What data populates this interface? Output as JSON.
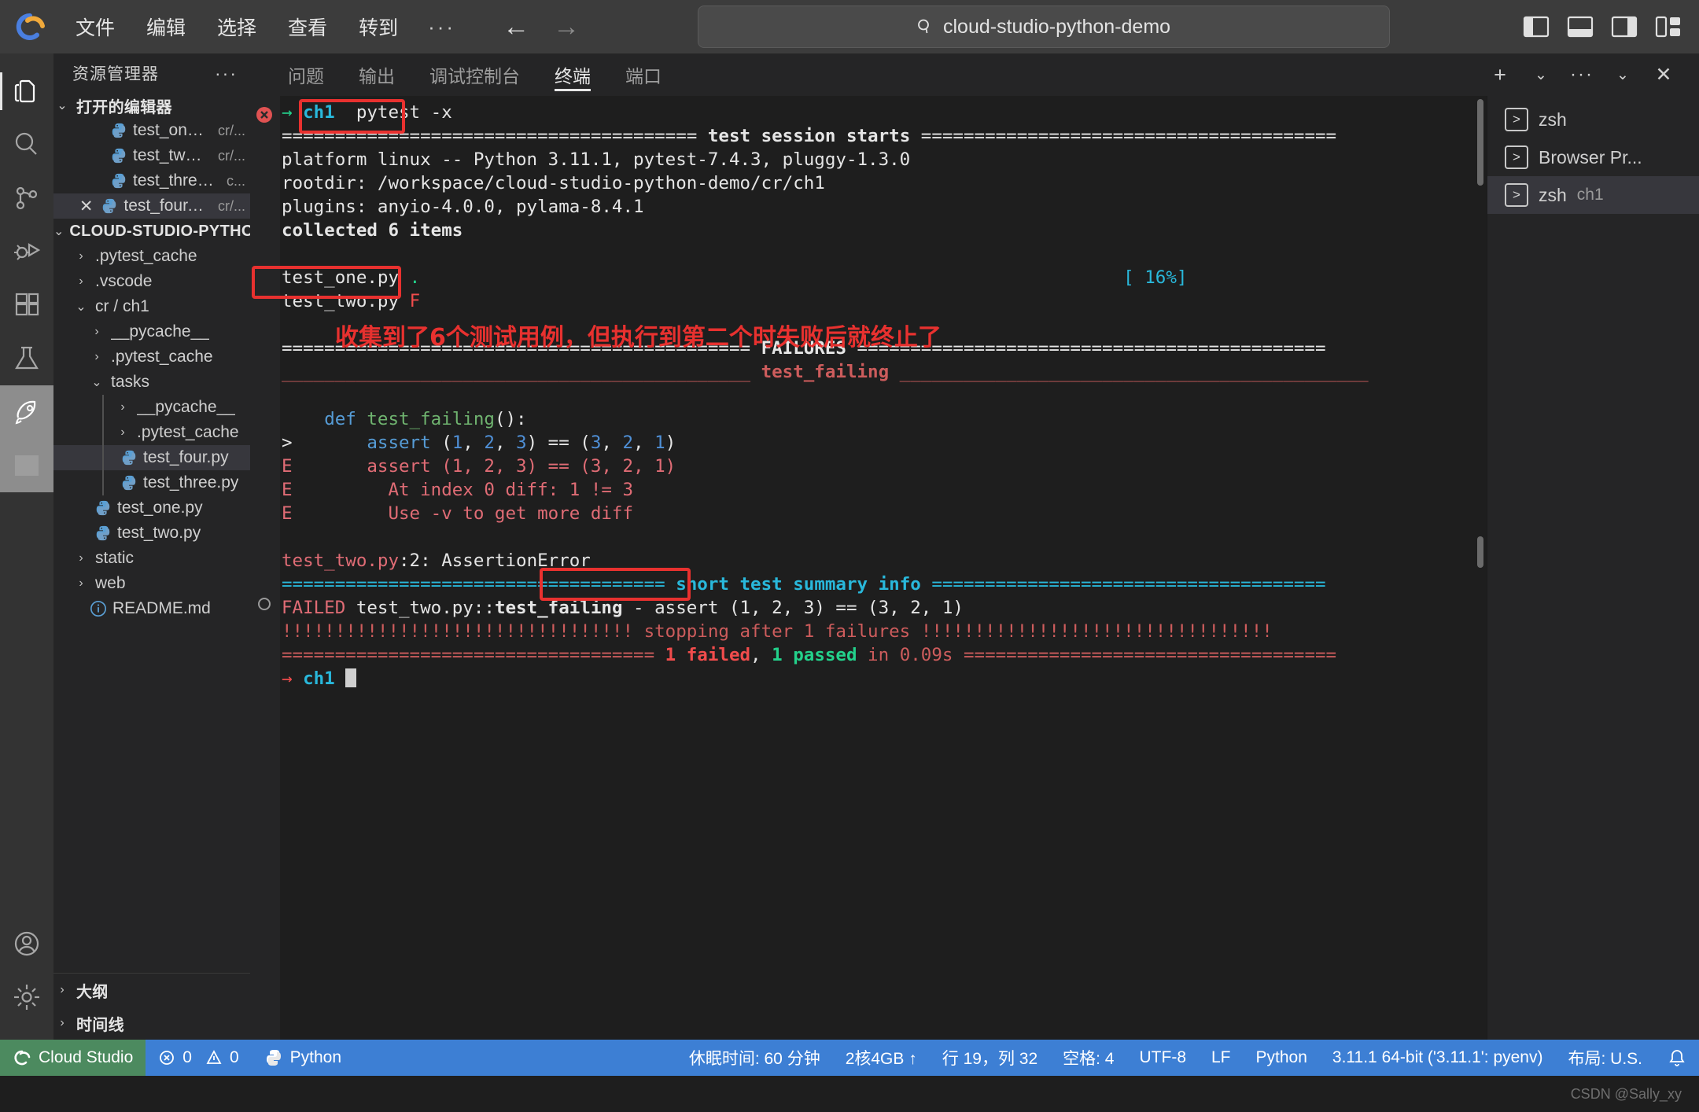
{
  "titlebar": {
    "menu": [
      "文件",
      "编辑",
      "选择",
      "查看",
      "转到"
    ],
    "more": "···",
    "back_icon": "arrow-left-icon",
    "forward_icon": "arrow-right-icon",
    "search_value": "cloud-studio-python-demo",
    "search_icon": "search-icon",
    "layout_icons": [
      "toggle-primary-sidebar-icon",
      "toggle-panel-icon",
      "toggle-secondary-sidebar-icon",
      "customize-layout-icon"
    ]
  },
  "activitybar": {
    "items": [
      {
        "name": "explorer-icon",
        "glyph": "files",
        "active": true
      },
      {
        "name": "search-icon",
        "glyph": "search",
        "active": false
      },
      {
        "name": "source-control-icon",
        "glyph": "branch",
        "active": false
      },
      {
        "name": "run-and-debug-icon",
        "glyph": "debug",
        "active": false
      },
      {
        "name": "extensions-icon",
        "glyph": "blocks",
        "active": false
      },
      {
        "name": "testing-icon",
        "glyph": "flask",
        "active": false
      },
      {
        "name": "rocket-icon",
        "glyph": "rocket",
        "active": false,
        "selected": true
      },
      {
        "name": "square-icon",
        "glyph": "square",
        "active": false,
        "selected": true
      }
    ],
    "bottom": [
      {
        "name": "accounts-icon",
        "glyph": "account"
      },
      {
        "name": "settings-gear-icon",
        "glyph": "gear"
      }
    ]
  },
  "sidebar": {
    "title": "资源管理器",
    "more": "···",
    "open_editors": {
      "label": "打开的编辑器",
      "expanded": true,
      "items": [
        {
          "name": "test_one.py",
          "path": "cr/...",
          "close": false
        },
        {
          "name": "test_two.py",
          "path": "cr/...",
          "close": false
        },
        {
          "name": "test_three.py",
          "path": "c...",
          "close": false
        },
        {
          "name": "test_four.py",
          "path": "cr/...",
          "close": true,
          "selected": true
        }
      ]
    },
    "project": {
      "label": "CLOUD-STUDIO-PYTHO...",
      "expanded": true,
      "items": [
        {
          "label": ".pytest_cache",
          "type": "folder",
          "expanded": false,
          "indent": 1
        },
        {
          "label": ".vscode",
          "type": "folder",
          "expanded": false,
          "indent": 1
        },
        {
          "label": "cr / ch1",
          "type": "folder",
          "expanded": true,
          "indent": 1
        },
        {
          "label": "__pycache__",
          "type": "folder",
          "expanded": false,
          "indent": 2
        },
        {
          "label": ".pytest_cache",
          "type": "folder",
          "expanded": false,
          "indent": 2
        },
        {
          "label": "tasks",
          "type": "folder",
          "expanded": true,
          "indent": 2
        },
        {
          "label": "__pycache__",
          "type": "folder",
          "expanded": false,
          "indent": 3,
          "guide": true
        },
        {
          "label": ".pytest_cache",
          "type": "folder",
          "expanded": false,
          "indent": 3,
          "guide": true
        },
        {
          "label": "test_four.py",
          "type": "python",
          "indent": 3,
          "guide": true,
          "selected": true
        },
        {
          "label": "test_three.py",
          "type": "python",
          "indent": 3,
          "guide": true
        },
        {
          "label": "test_one.py",
          "type": "python",
          "indent": 2
        },
        {
          "label": "test_two.py",
          "type": "python",
          "indent": 2
        },
        {
          "label": "static",
          "type": "folder",
          "expanded": false,
          "indent": 1
        },
        {
          "label": "web",
          "type": "folder",
          "expanded": false,
          "indent": 1
        },
        {
          "label": "README.md",
          "type": "readme",
          "indent": 1
        }
      ]
    },
    "footer": [
      {
        "label": "大纲",
        "expanded": false
      },
      {
        "label": "时间线",
        "expanded": false
      }
    ]
  },
  "panel": {
    "tabs": [
      {
        "label": "问题",
        "active": false
      },
      {
        "label": "输出",
        "active": false
      },
      {
        "label": "调试控制台",
        "active": false
      },
      {
        "label": "终端",
        "active": true
      },
      {
        "label": "端口",
        "active": false
      }
    ],
    "tools": [
      {
        "name": "new-terminal-icon",
        "glyph": "+"
      },
      {
        "name": "terminal-dropdown-icon",
        "glyph": "v"
      },
      {
        "name": "panel-more-icon",
        "glyph": "···"
      },
      {
        "name": "collapse-panel-icon",
        "glyph": "v"
      },
      {
        "name": "close-panel-icon",
        "glyph": "✕"
      }
    ]
  },
  "terminal": {
    "prompt1": {
      "arrow": "→",
      "dir": "ch1",
      "command": "pytest -x",
      "error_mark": true
    },
    "lines": [
      {
        "segs": [
          {
            "t": "======================================= ",
            "c": "c-white"
          },
          {
            "t": "test session starts",
            "c": "c-white b"
          },
          {
            "t": " =======================================",
            "c": "c-white"
          }
        ]
      },
      {
        "segs": [
          {
            "t": "platform linux -- Python 3.11.1, pytest-7.4.3, pluggy-1.3.0",
            "c": "c-white"
          }
        ]
      },
      {
        "segs": [
          {
            "t": "rootdir: /workspace/cloud-studio-python-demo/cr/ch1",
            "c": "c-white"
          }
        ]
      },
      {
        "segs": [
          {
            "t": "plugins: anyio-4.0.0, pylama-8.4.1",
            "c": "c-white"
          }
        ]
      },
      {
        "segs": [
          {
            "t": "collected 6 items",
            "c": "c-white b"
          }
        ]
      },
      {
        "segs": [
          {
            "t": "",
            "c": "c-white"
          }
        ]
      },
      {
        "segs": [
          {
            "t": "test_one.py ",
            "c": "c-white"
          },
          {
            "t": ".",
            "c": "c-green"
          },
          {
            "t": "                                                                  ",
            "c": "c-white"
          },
          {
            "t": "[ 16%]",
            "c": "c-cyan"
          }
        ]
      },
      {
        "segs": [
          {
            "t": "test_two.py ",
            "c": "c-white"
          },
          {
            "t": "F",
            "c": "c-red"
          }
        ]
      },
      {
        "segs": [
          {
            "t": "",
            "c": "c-white"
          }
        ]
      },
      {
        "segs": [
          {
            "t": "============================================ ",
            "c": "c-white"
          },
          {
            "t": "FAILURES",
            "c": "c-white b"
          },
          {
            "t": " ============================================",
            "c": "c-white"
          }
        ]
      },
      {
        "segs": [
          {
            "t": "____________________________________________ ",
            "c": "c-redl"
          },
          {
            "t": "test_failing",
            "c": "c-redl b"
          },
          {
            "t": " ____________________________________________",
            "c": "c-redl"
          }
        ]
      },
      {
        "segs": [
          {
            "t": "",
            "c": "c-white"
          }
        ]
      },
      {
        "segs": [
          {
            "t": "    ",
            "c": "c-white"
          },
          {
            "t": "def",
            "c": "c-blue"
          },
          {
            "t": " ",
            "c": "c-white"
          },
          {
            "t": "test_failing",
            "c": "c-func"
          },
          {
            "t": "():",
            "c": "c-white"
          }
        ]
      },
      {
        "segs": [
          {
            "t": ">       ",
            "c": "c-white"
          },
          {
            "t": "assert",
            "c": "c-blue"
          },
          {
            "t": " (",
            "c": "c-white"
          },
          {
            "t": "1",
            "c": "c-num"
          },
          {
            "t": ", ",
            "c": "c-white"
          },
          {
            "t": "2",
            "c": "c-num"
          },
          {
            "t": ", ",
            "c": "c-white"
          },
          {
            "t": "3",
            "c": "c-num"
          },
          {
            "t": ") == (",
            "c": "c-white"
          },
          {
            "t": "3",
            "c": "c-num"
          },
          {
            "t": ", ",
            "c": "c-white"
          },
          {
            "t": "2",
            "c": "c-num"
          },
          {
            "t": ", ",
            "c": "c-white"
          },
          {
            "t": "1",
            "c": "c-num"
          },
          {
            "t": ")",
            "c": "c-white"
          }
        ]
      },
      {
        "segs": [
          {
            "t": "E       assert (1, 2, 3) == (3, 2, 1)",
            "c": "c-pink"
          }
        ]
      },
      {
        "segs": [
          {
            "t": "E         At index 0 diff: 1 != 3",
            "c": "c-pink"
          }
        ]
      },
      {
        "segs": [
          {
            "t": "E         Use -v to get more diff",
            "c": "c-pink"
          }
        ]
      },
      {
        "segs": [
          {
            "t": "",
            "c": "c-white"
          }
        ]
      },
      {
        "segs": [
          {
            "t": "test_two.py",
            "c": "c-pink"
          },
          {
            "t": ":2: AssertionError",
            "c": "c-white"
          }
        ]
      },
      {
        "segs": [
          {
            "t": "==================================== ",
            "c": "c-cyan"
          },
          {
            "t": "short test summary info",
            "c": "c-cyan b"
          },
          {
            "t": " =====================================",
            "c": "c-cyan"
          }
        ]
      },
      {
        "segs": [
          {
            "t": "FAILED",
            "c": "c-pink"
          },
          {
            "t": " test_two.py::",
            "c": "c-white"
          },
          {
            "t": "test_failing",
            "c": "c-white b"
          },
          {
            "t": " - assert (1, 2, 3) == (3, 2, 1)",
            "c": "c-white"
          }
        ]
      },
      {
        "segs": [
          {
            "t": "!!!!!!!!!!!!!!!!!!!!!!!!!!!!!!!!! stopping after 1 failures !!!!!!!!!!!!!!!!!!!!!!!!!!!!!!!!!",
            "c": "c-redl"
          }
        ]
      },
      {
        "segs": [
          {
            "t": "=================================== ",
            "c": "c-redl"
          },
          {
            "t": "1 failed",
            "c": "c-red b"
          },
          {
            "t": ", ",
            "c": "c-white"
          },
          {
            "t": "1 passed",
            "c": "c-green b"
          },
          {
            "t": " in 0.09s ===================================",
            "c": "c-redl"
          }
        ]
      }
    ],
    "prompt2": {
      "arrow": "→",
      "dir": "ch1"
    },
    "annotation": "收集到了6个测试用例，但执行到第二个时失败后就终止了",
    "highlight_boxes": [
      "pytest -x",
      "collected 6 items",
      "1 failed, 1 passed"
    ]
  },
  "terminal_list": [
    {
      "label": "zsh",
      "sub": "",
      "active": false
    },
    {
      "label": "Browser Pr...",
      "sub": "",
      "active": false
    },
    {
      "label": "zsh",
      "sub": "ch1",
      "active": true
    }
  ],
  "statusbar": {
    "brand": "Cloud Studio",
    "brand_icon": "cloud-studio-icon",
    "errors": "0",
    "warnings": "0",
    "error_icon": "error-circle-icon",
    "warning_icon": "warning-triangle-icon",
    "language_env": "Python",
    "python_icon": "python-icon",
    "sleep": "休眠时间: 60 分钟",
    "resources": "2核4GB ↑",
    "cursor": "行 19，列 32",
    "spaces": "空格: 4",
    "encoding": "UTF-8",
    "eol": "LF",
    "language": "Python",
    "interpreter": "3.11.1 64-bit ('3.11.1': pyenv)",
    "layout": "布局: U.S.",
    "bell_icon": "bell-icon"
  },
  "watermark": "CSDN @Sally_xy",
  "colors": {
    "accent": "#3d7fd4",
    "brand_green": "#4c8a5f",
    "annotation_red": "#e8312f",
    "terminal_bg": "#1e1e1e",
    "sidebar_bg": "#252526"
  }
}
